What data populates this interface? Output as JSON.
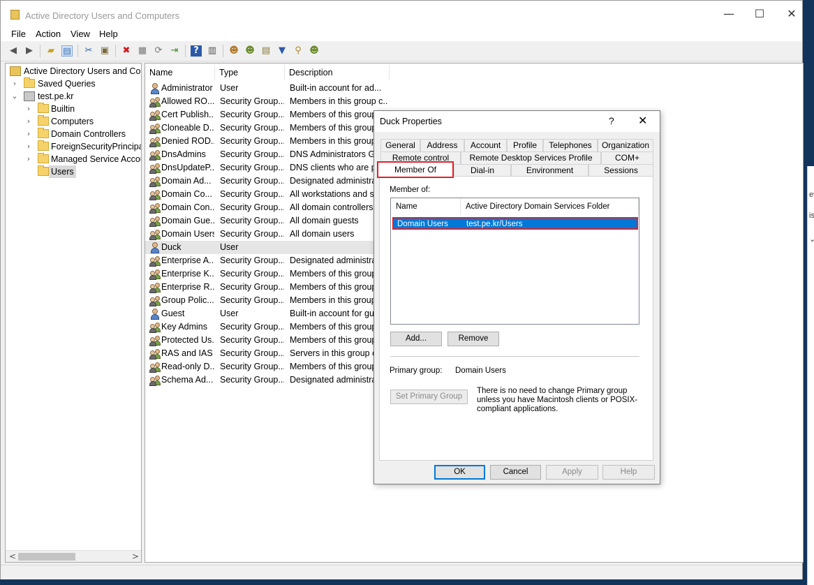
{
  "window": {
    "title": "Active Directory Users and Computers",
    "controls": {
      "minimize": "—",
      "maximize": "☐",
      "close": "✕"
    }
  },
  "menu": [
    "File",
    "Action",
    "View",
    "Help"
  ],
  "toolbar_icons": [
    "back-arrow-icon",
    "forward-arrow-icon",
    "up-folder-icon",
    "show-hide-tree-icon",
    "cut-icon",
    "copy-icon",
    "delete-icon",
    "properties-icon",
    "refresh-icon",
    "export-list-icon",
    "help-icon",
    "mmc-view-icon",
    "new-user-icon",
    "new-group-icon",
    "new-ou-icon",
    "filter-icon",
    "find-icon",
    "add-to-group-icon"
  ],
  "tree": {
    "root": "Active Directory Users and Com",
    "items": [
      {
        "label": "Saved Queries",
        "level": 1,
        "expander": "›"
      },
      {
        "label": "test.pe.kr",
        "level": 1,
        "expander": "⌄"
      },
      {
        "label": "Builtin",
        "level": 2,
        "expander": "›"
      },
      {
        "label": "Computers",
        "level": 2,
        "expander": "›"
      },
      {
        "label": "Domain Controllers",
        "level": 2,
        "expander": "›"
      },
      {
        "label": "ForeignSecurityPrincipals",
        "level": 2,
        "expander": "›"
      },
      {
        "label": "Managed Service Accour",
        "level": 2,
        "expander": "›"
      },
      {
        "label": "Users",
        "level": 2,
        "expander": "",
        "selected": true
      }
    ],
    "scroll_left": "<",
    "scroll_right": ">"
  },
  "list": {
    "columns": [
      "Name",
      "Type",
      "Description"
    ],
    "rows": [
      {
        "name": "Administrator",
        "type": "User",
        "desc": "Built-in account for ad...",
        "icon": "user"
      },
      {
        "name": "Allowed RO...",
        "type": "Security Group...",
        "desc": "Members in this group c...",
        "icon": "group"
      },
      {
        "name": "Cert Publish...",
        "type": "Security Group...",
        "desc": "Members of this group",
        "icon": "group"
      },
      {
        "name": "Cloneable D...",
        "type": "Security Group...",
        "desc": "Members of this group",
        "icon": "group"
      },
      {
        "name": "Denied ROD...",
        "type": "Security Group...",
        "desc": "Members in this group",
        "icon": "group"
      },
      {
        "name": "DnsAdmins",
        "type": "Security Group...",
        "desc": "DNS Administrators Gro",
        "icon": "group"
      },
      {
        "name": "DnsUpdateP...",
        "type": "Security Group...",
        "desc": "DNS clients who are pe",
        "icon": "group"
      },
      {
        "name": "Domain Ad...",
        "type": "Security Group...",
        "desc": "Designated administrat",
        "icon": "group"
      },
      {
        "name": "Domain Co...",
        "type": "Security Group...",
        "desc": "All workstations and se",
        "icon": "group"
      },
      {
        "name": "Domain Con...",
        "type": "Security Group...",
        "desc": "All domain controllers i",
        "icon": "group"
      },
      {
        "name": "Domain Gue...",
        "type": "Security Group...",
        "desc": "All domain guests",
        "icon": "group"
      },
      {
        "name": "Domain Users",
        "type": "Security Group...",
        "desc": "All domain users",
        "icon": "group"
      },
      {
        "name": "Duck",
        "type": "User",
        "desc": "",
        "icon": "user",
        "selected": true
      },
      {
        "name": "Enterprise A...",
        "type": "Security Group...",
        "desc": "Designated administrat",
        "icon": "group"
      },
      {
        "name": "Enterprise K...",
        "type": "Security Group...",
        "desc": "Members of this group",
        "icon": "group"
      },
      {
        "name": "Enterprise R...",
        "type": "Security Group...",
        "desc": "Members of this group",
        "icon": "group"
      },
      {
        "name": "Group Polic...",
        "type": "Security Group...",
        "desc": "Members in this group",
        "icon": "group"
      },
      {
        "name": "Guest",
        "type": "User",
        "desc": "Built-in account for gue",
        "icon": "user"
      },
      {
        "name": "Key Admins",
        "type": "Security Group...",
        "desc": "Members of this group",
        "icon": "group"
      },
      {
        "name": "Protected Us...",
        "type": "Security Group...",
        "desc": "Members of this group",
        "icon": "group"
      },
      {
        "name": "RAS and IAS ...",
        "type": "Security Group...",
        "desc": "Servers in this group ca",
        "icon": "group"
      },
      {
        "name": "Read-only D...",
        "type": "Security Group...",
        "desc": "Members of this group",
        "icon": "group"
      },
      {
        "name": "Schema Ad...",
        "type": "Security Group...",
        "desc": "Designated administrat",
        "icon": "group"
      }
    ]
  },
  "background_window_text": [
    "ev",
    "is",
    "⌄"
  ],
  "dialog": {
    "title": "Duck Properties",
    "help": "?",
    "close": "✕",
    "tabs_row1": [
      "General",
      "Address",
      "Account",
      "Profile",
      "Telephones",
      "Organization"
    ],
    "tabs_row2": [
      "Remote control",
      "Remote Desktop Services Profile",
      "COM+"
    ],
    "tabs_row3": [
      "Member Of",
      "Dial-in",
      "Environment",
      "Sessions"
    ],
    "member_of_label": "Member of:",
    "member_columns": [
      "Name",
      "Active Directory Domain Services Folder"
    ],
    "members": [
      {
        "name": "Domain Users",
        "folder": "test.pe.kr/Users"
      }
    ],
    "add_button": "Add...",
    "remove_button": "Remove",
    "primary_group_label": "Primary group:",
    "primary_group_value": "Domain Users",
    "set_primary_button": "Set Primary Group",
    "note": "There is no need to change Primary group unless you have Macintosh clients or POSIX-compliant applications.",
    "ok": "OK",
    "cancel": "Cancel",
    "apply": "Apply",
    "help_button": "Help"
  },
  "colors": {
    "selection": "#0078d7",
    "highlight_box": "#e0202a",
    "desktop": "#12345a"
  }
}
